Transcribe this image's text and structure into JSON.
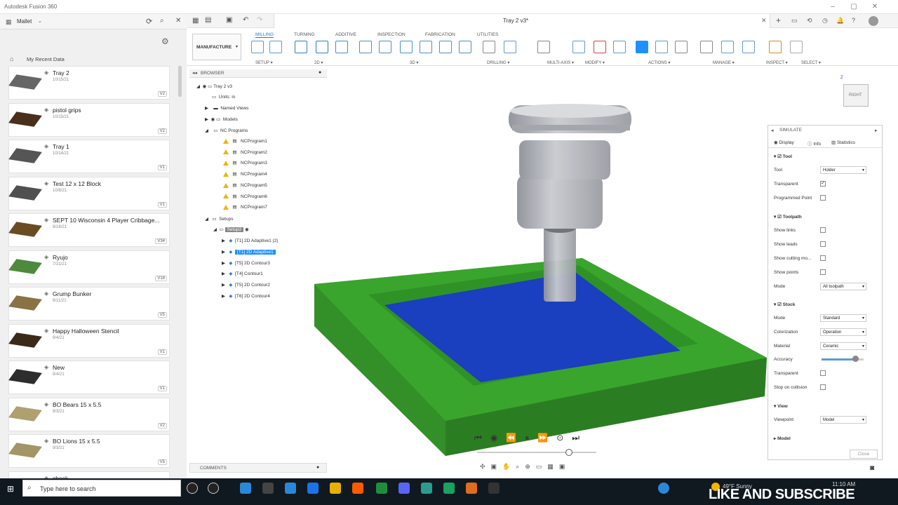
{
  "window": {
    "title": "Autodesk Fusion 360",
    "doc_tab": "Tray 2 v3*"
  },
  "data_panel": {
    "project": "Mallet",
    "section": "My Recent Data",
    "items": [
      {
        "name": "Tray 2",
        "date": "10/15/21",
        "version": "V2"
      },
      {
        "name": "pistol grips",
        "date": "10/15/21",
        "version": "V2"
      },
      {
        "name": "Tray 1",
        "date": "10/14/21",
        "version": "V1"
      },
      {
        "name": "Test 12 x 12 Block",
        "date": "10/8/21",
        "version": "V1"
      },
      {
        "name": "SEPT 10 Wisconsin 4 Player Cribbage...",
        "date": "9/18/21",
        "version": "V34"
      },
      {
        "name": "Ryujo",
        "date": "7/21/21",
        "version": "V18"
      },
      {
        "name": "Grump Bunker",
        "date": "9/11/21",
        "version": "V5"
      },
      {
        "name": "Happy Halloween Stencil",
        "date": "9/4/21",
        "version": "V1"
      },
      {
        "name": "New",
        "date": "9/4/21",
        "version": "V1"
      },
      {
        "name": "BO Bears 15 x 5.5",
        "date": "9/3/21",
        "version": "V2"
      },
      {
        "name": "BO Lions 15 x 5.5",
        "date": "9/3/21",
        "version": "V5"
      },
      {
        "name": "check",
        "date": "",
        "version": ""
      }
    ]
  },
  "ribbon": {
    "workspace": "MANUFACTURE",
    "tabs": [
      "MILLING",
      "TURNING",
      "ADDITIVE",
      "INSPECTION",
      "FABRICATION",
      "UTILITIES"
    ],
    "groups": [
      "SETUP",
      "2D",
      "3D",
      "DRILLING",
      "MULTI-AXIS",
      "MODIFY",
      "ACTIONS",
      "MANAGE",
      "INSPECT",
      "SELECT"
    ]
  },
  "browser": {
    "title": "BROWSER",
    "root": "Tray 2 v3",
    "units": "Units: in",
    "named_views": "Named Views",
    "models": "Models",
    "nc_programs": "NC Programs",
    "programs": [
      "NCProgram1",
      "NCProgram2",
      "NCProgram3",
      "NCProgram4",
      "NCProgram5",
      "NCProgram6",
      "NCProgram7"
    ],
    "setups": "Setups",
    "setup": "Setup2",
    "ops": [
      "[T1] 2D Adaptive1 (2)",
      "[T1] 2D Adaptive1",
      "[T5] 2D Contour3",
      "[T4] Contour1",
      "[T5] 2D Contour2",
      "[T6] 2D Contour4"
    ]
  },
  "comments": "COMMENTS",
  "simulate": {
    "title": "SIMULATE",
    "tabs": [
      "Display",
      "Info",
      "Statistics"
    ],
    "tool_section": "Tool",
    "tool_label": "Tool",
    "tool_value": "Holder",
    "transparent": "Transparent",
    "programmed_point": "Programmed Point",
    "toolpath_section": "Toolpath",
    "show_links": "Show links",
    "show_leads": "Show leads",
    "show_cutting": "Show cutting mo...",
    "show_points": "Show points",
    "mode_label": "Mode",
    "toolpath_mode": "All toolpath",
    "stock_section": "Stock",
    "stock_mode": "Standard",
    "colorization_label": "Colorization",
    "colorization": "Operation",
    "material_label": "Material",
    "material": "Ceramic",
    "accuracy_label": "Accuracy",
    "accuracy": 0.8,
    "stock_transparent": "Transparent",
    "stop_on_collision": "Stop on collision",
    "view_section": "View",
    "viewpoint_label": "Viewpoint",
    "viewpoint": "Model",
    "model_section": "Model",
    "close": "Close"
  },
  "viewcube": {
    "face": "RIGHT"
  },
  "taskbar": {
    "search_placeholder": "Type here to search",
    "weather": "49°F Sunny",
    "time": "11:10 AM",
    "overlay": "LIKE AND SUBSCRIBE"
  },
  "colors": {
    "stock": "#3aa52c",
    "pocket": "#1a3fbf",
    "selected": "#1e90ff"
  }
}
